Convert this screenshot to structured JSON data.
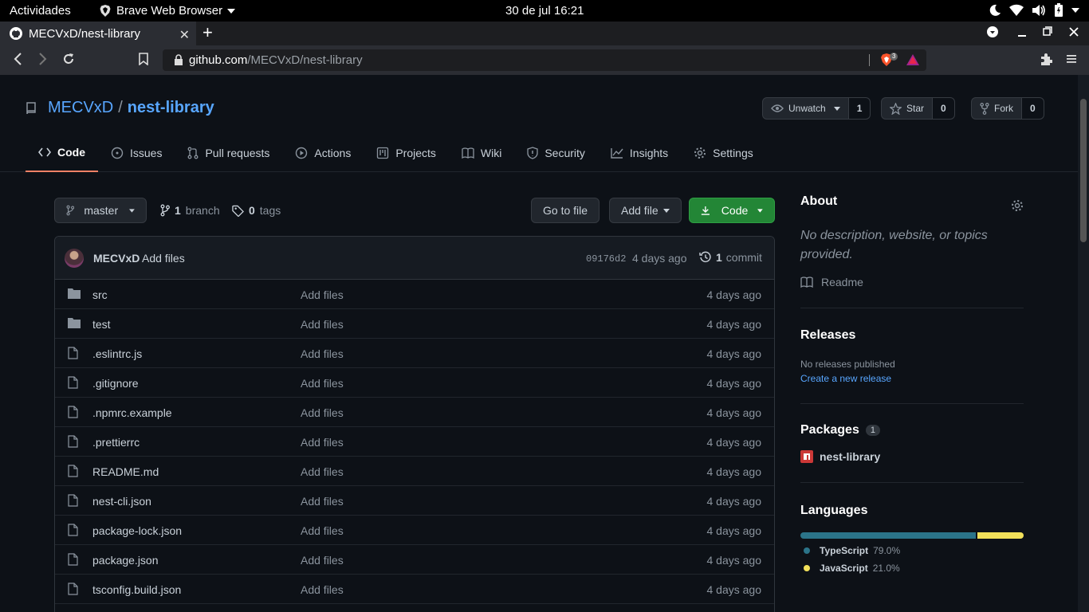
{
  "os": {
    "activities": "Actividades",
    "app_name": "Brave Web Browser",
    "clock": "30 de jul  16:21"
  },
  "browser": {
    "tab_title": "MECVxD/nest-library",
    "url_host": "github.com",
    "url_path": "/MECVxD/nest-library",
    "shields_count": "3"
  },
  "repo": {
    "owner": "MECVxD",
    "separator": "/",
    "name": "nest-library",
    "unwatch_label": "Unwatch",
    "watch_count": "1",
    "star_label": "Star",
    "star_count": "0",
    "fork_label": "Fork",
    "fork_count": "0"
  },
  "nav": [
    {
      "label": "Code",
      "icon": "code-icon"
    },
    {
      "label": "Issues",
      "icon": "issue-icon"
    },
    {
      "label": "Pull requests",
      "icon": "pull-request-icon"
    },
    {
      "label": "Actions",
      "icon": "play-icon"
    },
    {
      "label": "Projects",
      "icon": "project-icon"
    },
    {
      "label": "Wiki",
      "icon": "book-icon"
    },
    {
      "label": "Security",
      "icon": "shield-icon"
    },
    {
      "label": "Insights",
      "icon": "graph-icon"
    },
    {
      "label": "Settings",
      "icon": "gear-icon"
    }
  ],
  "toolbar": {
    "branch": "master",
    "branch_count": "1",
    "branch_label": "branch",
    "tag_count": "0",
    "tag_label": "tags",
    "goto_file": "Go to file",
    "add_file": "Add file",
    "code": "Code"
  },
  "commit": {
    "author": "MECVxD",
    "message": "Add files",
    "sha": "09176d2",
    "age": "4 days ago",
    "count": "1",
    "count_label": "commit"
  },
  "files": [
    {
      "name": "src",
      "type": "folder",
      "message": "Add files",
      "age": "4 days ago"
    },
    {
      "name": "test",
      "type": "folder",
      "message": "Add files",
      "age": "4 days ago"
    },
    {
      "name": ".eslintrc.js",
      "type": "file",
      "message": "Add files",
      "age": "4 days ago"
    },
    {
      "name": ".gitignore",
      "type": "file",
      "message": "Add files",
      "age": "4 days ago"
    },
    {
      "name": ".npmrc.example",
      "type": "file",
      "message": "Add files",
      "age": "4 days ago"
    },
    {
      "name": ".prettierrc",
      "type": "file",
      "message": "Add files",
      "age": "4 days ago"
    },
    {
      "name": "README.md",
      "type": "file",
      "message": "Add files",
      "age": "4 days ago"
    },
    {
      "name": "nest-cli.json",
      "type": "file",
      "message": "Add files",
      "age": "4 days ago"
    },
    {
      "name": "package-lock.json",
      "type": "file",
      "message": "Add files",
      "age": "4 days ago"
    },
    {
      "name": "package.json",
      "type": "file",
      "message": "Add files",
      "age": "4 days ago"
    },
    {
      "name": "tsconfig.build.json",
      "type": "file",
      "message": "Add files",
      "age": "4 days ago"
    }
  ],
  "sidebar": {
    "about_title": "About",
    "about_desc": "No description, website, or topics provided.",
    "readme": "Readme",
    "releases_title": "Releases",
    "no_releases": "No releases published",
    "create_release": "Create a new release",
    "packages_title": "Packages",
    "packages_count": "1",
    "package_name": "nest-library",
    "languages_title": "Languages",
    "languages": [
      {
        "name": "TypeScript",
        "percent": "79.0%",
        "value": 79.0,
        "color": "#2b7489"
      },
      {
        "name": "JavaScript",
        "percent": "21.0%",
        "value": 21.0,
        "color": "#f1e05a"
      }
    ]
  }
}
